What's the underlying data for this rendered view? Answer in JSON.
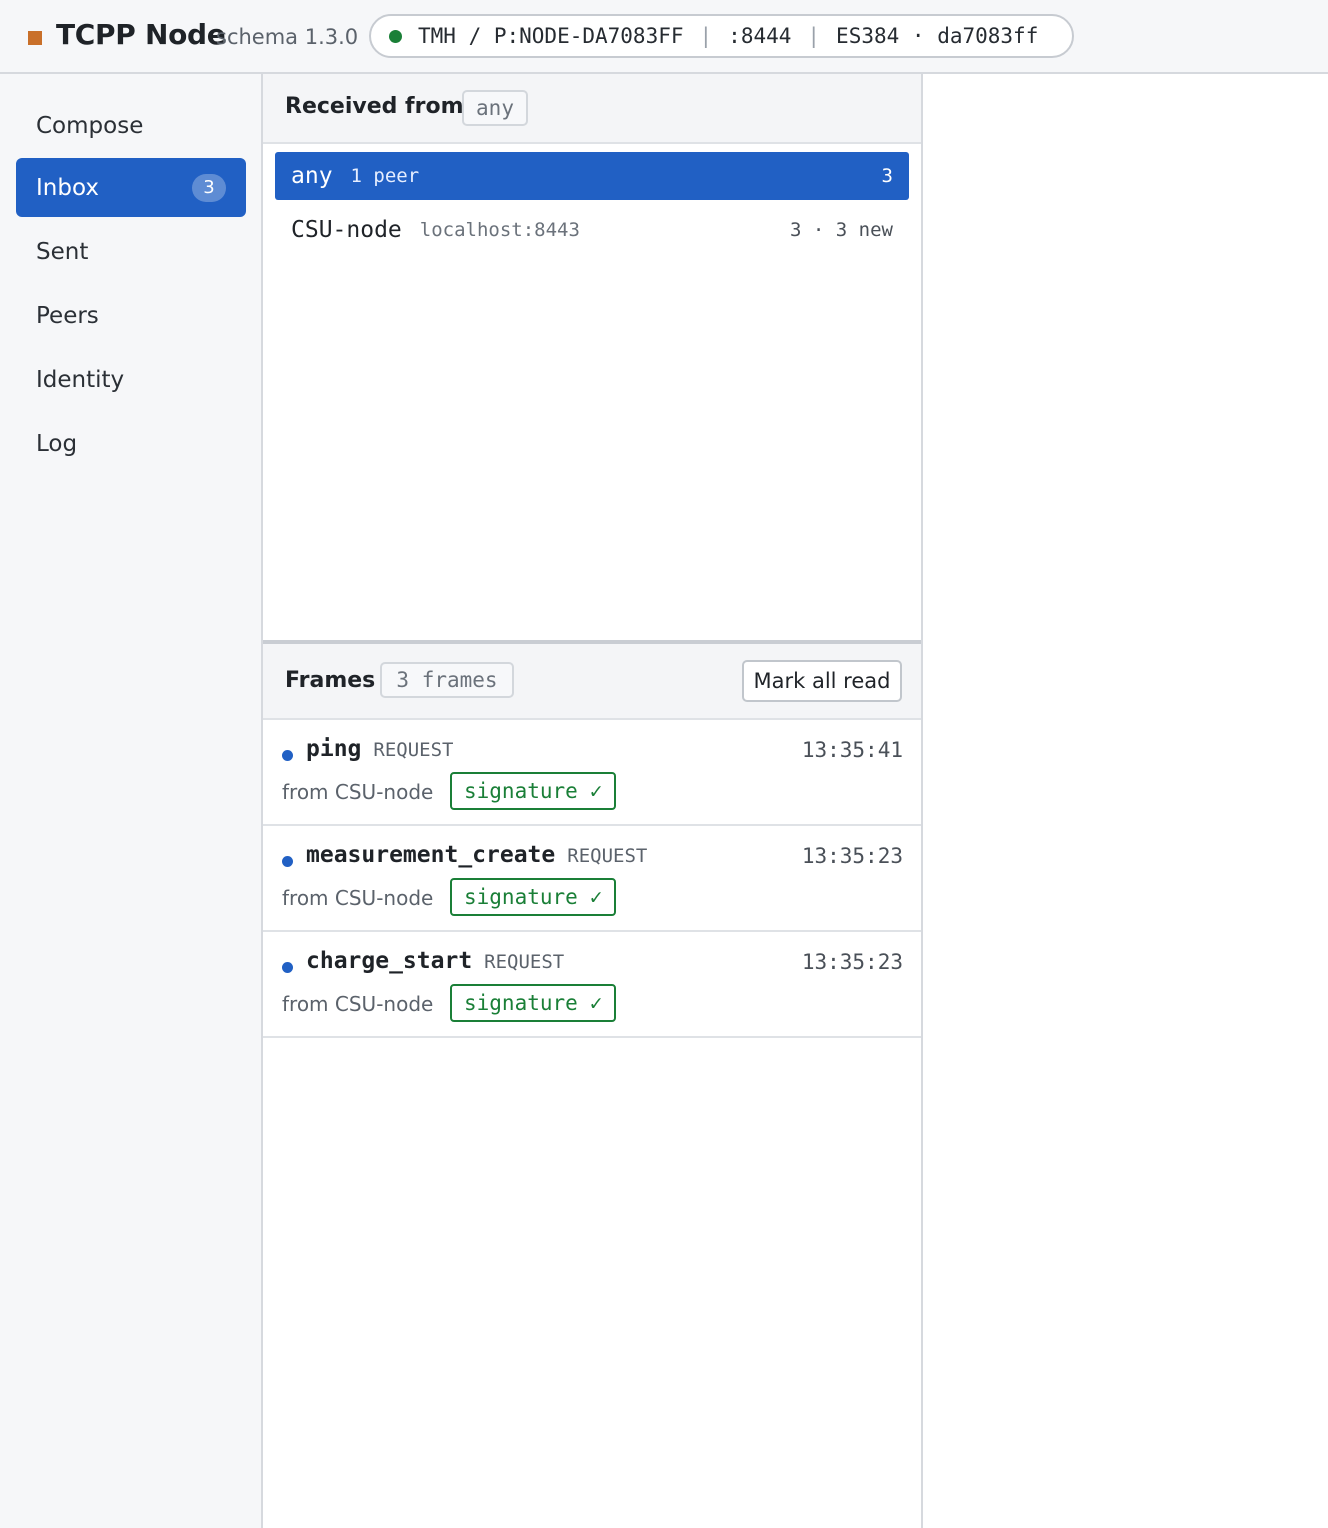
{
  "header": {
    "app_name": "TCPP Node",
    "schema": "schema 1.3.0",
    "identity": {
      "node": "TMH / P:NODE-DA7083FF",
      "port": ":8444",
      "key": "ES384 · da7083ff",
      "status_color": "#1a7f37"
    }
  },
  "sidebar": {
    "items": [
      {
        "label": "Compose"
      },
      {
        "label": "Inbox",
        "badge": "3"
      },
      {
        "label": "Sent"
      },
      {
        "label": "Peers"
      },
      {
        "label": "Identity"
      },
      {
        "label": "Log"
      }
    ],
    "active": "Inbox",
    "accent": "#2160c4"
  },
  "received": {
    "title": "Received from",
    "filter": "any",
    "peers": [
      {
        "name": "any",
        "sub": "1 peer",
        "count": "3",
        "selected": true
      },
      {
        "name": "CSU-node",
        "sub": "localhost:8443",
        "count": "3 · 3 new",
        "selected": false
      }
    ]
  },
  "frames": {
    "title": "Frames",
    "count_label": "3 frames",
    "mark_all_label": "Mark all read",
    "items": [
      {
        "name": "ping",
        "kind": "REQUEST",
        "time": "13:35:41",
        "from": "from CSU-node",
        "signature": "signature",
        "check": "✓"
      },
      {
        "name": "measurement_create",
        "kind": "REQUEST",
        "time": "13:35:23",
        "from": "from CSU-node",
        "signature": "signature",
        "check": "✓"
      },
      {
        "name": "charge_start",
        "kind": "REQUEST",
        "time": "13:35:23",
        "from": "from CSU-node",
        "signature": "signature",
        "check": "✓"
      }
    ]
  }
}
